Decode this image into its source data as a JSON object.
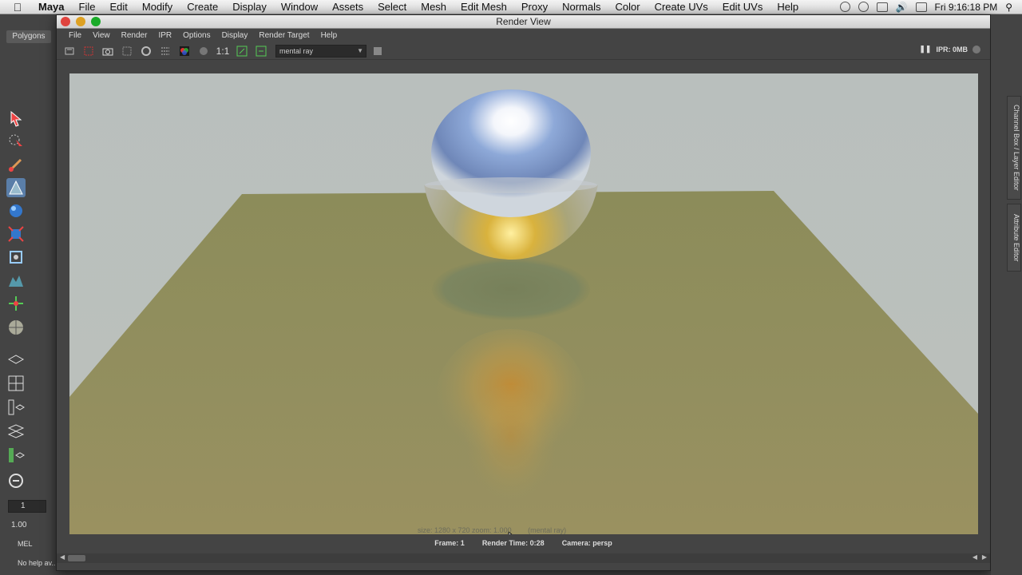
{
  "menubar": {
    "app": "Maya",
    "items": [
      "File",
      "Edit",
      "Modify",
      "Create",
      "Display",
      "Window",
      "Assets",
      "Select",
      "Mesh",
      "Edit Mesh",
      "Proxy",
      "Normals",
      "Color",
      "Create UVs",
      "Edit UVs",
      "Help"
    ],
    "clock": "Fri 9:16:18 PM"
  },
  "shelf": {
    "tab": "Polygons",
    "frame_field": "1",
    "value_field": "1.00",
    "mel_label": "MEL",
    "help_line": "No help av..."
  },
  "render_view": {
    "title": "Render View",
    "menus": [
      "File",
      "View",
      "Render",
      "IPR",
      "Options",
      "Display",
      "Render Target",
      "Help"
    ],
    "ratio_label": "1:1",
    "renderer": "mental ray",
    "ipr_status": "IPR: 0MB",
    "size_info": "size: 1280 x 720 zoom: 1.000",
    "renderer_info": "(mental ray)",
    "frame": "Frame: 1",
    "render_time": "Render Time: 0:28",
    "camera": "Camera: persp"
  },
  "side_tabs": {
    "channel_box": "Channel Box / Layer Editor",
    "attribute_editor": "Attribute Editor"
  },
  "colors": {
    "sky": "#b7bdbb",
    "ground": "#8f8f5a",
    "sphere_top": "#a9c4ea",
    "sphere_bottom": "#c9a93a",
    "shadow": "#7d8660"
  }
}
